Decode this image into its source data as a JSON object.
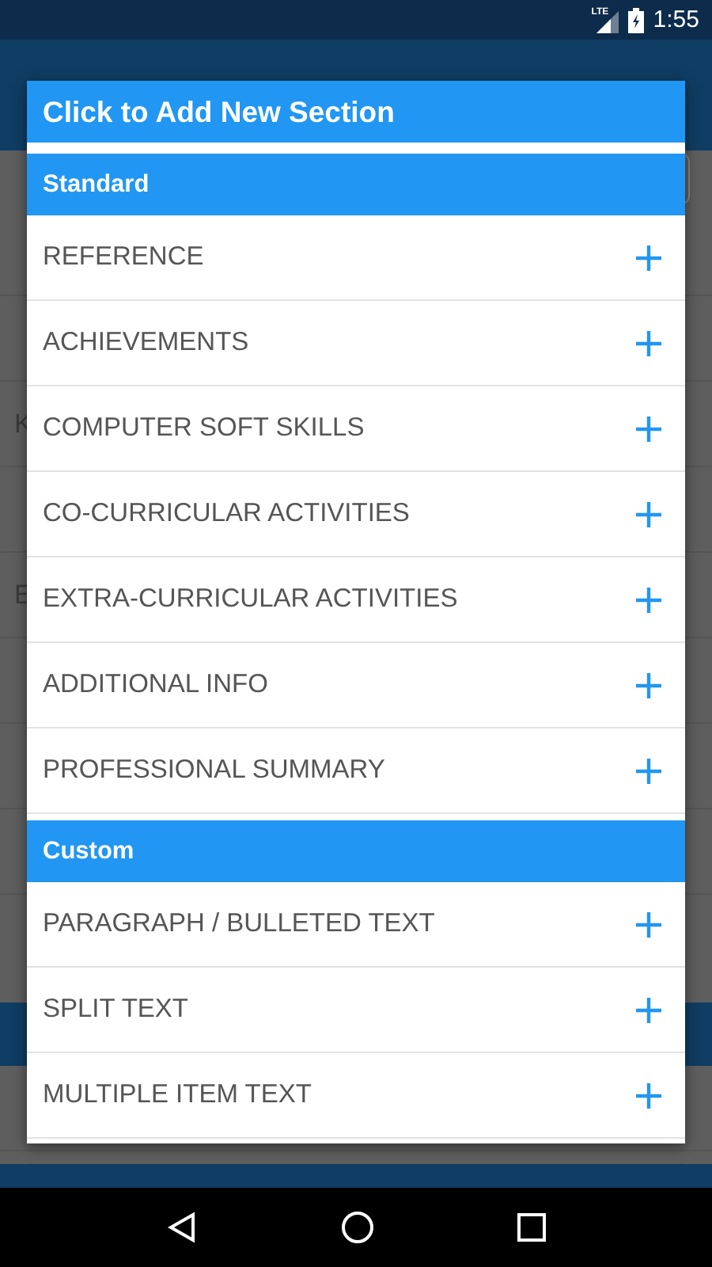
{
  "status_bar": {
    "network": "LTE",
    "time": "1:55"
  },
  "background": {
    "rows": [
      {
        "kind": "blank"
      },
      {
        "kind": "blank"
      },
      {
        "kind": "text",
        "initial": "K"
      },
      {
        "kind": "blank"
      },
      {
        "kind": "text",
        "initial": "E"
      },
      {
        "kind": "blank"
      },
      {
        "kind": "blank"
      },
      {
        "kind": "blank"
      }
    ]
  },
  "dialog": {
    "title": "Click to Add New Section",
    "groups": [
      {
        "header": "Standard",
        "items": [
          "REFERENCE",
          "ACHIEVEMENTS",
          "COMPUTER SOFT SKILLS",
          "CO-CURRICULAR ACTIVITIES",
          "EXTRA-CURRICULAR ACTIVITIES",
          "ADDITIONAL INFO",
          "PROFESSIONAL SUMMARY"
        ]
      },
      {
        "header": "Custom",
        "items": [
          "PARAGRAPH / BULLETED TEXT",
          "SPLIT TEXT",
          "MULTIPLE ITEM TEXT"
        ]
      }
    ]
  }
}
